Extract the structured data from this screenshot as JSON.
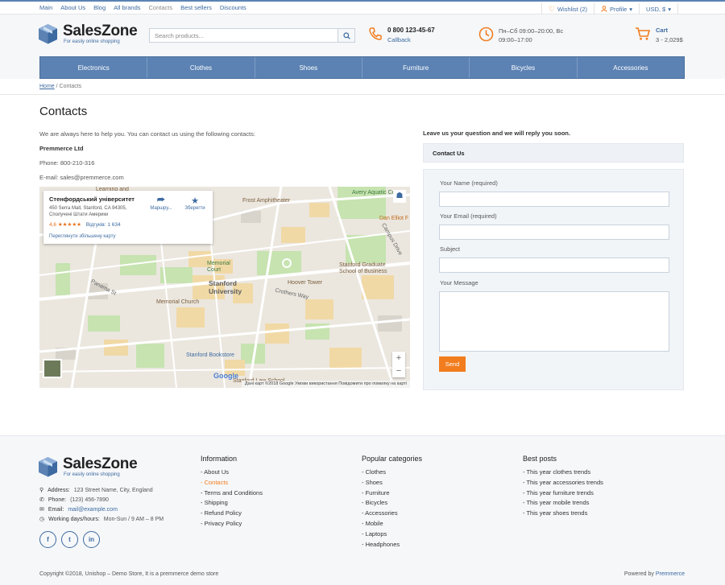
{
  "topnav": {
    "items": [
      "Main",
      "About Us",
      "Blog",
      "All brands",
      "Contacts",
      "Best sellers",
      "Discounts"
    ],
    "active_index": 4
  },
  "topright": {
    "wishlist": "Wishlist (2)",
    "profile": "Profile",
    "currency": "USD, $"
  },
  "header": {
    "logo_title": "SalesZone",
    "logo_subtitle": "For easily online shopping",
    "search_placeholder": "Search products...",
    "phone_number": "0 800 123-45-67",
    "callback": "Callback",
    "hours_line1": "Пн–Сб 09:00–20:00, Вс",
    "hours_line2": "09:00–17:00",
    "cart_label": "Cart",
    "cart_summary": "3 - 2,029$"
  },
  "mainnav": [
    "Electronics",
    "Clothes",
    "Shoes",
    "Furniture",
    "Bicycles",
    "Accessories"
  ],
  "breadcrumb": {
    "home": "Home",
    "sep": "/",
    "current": "Contacts"
  },
  "content": {
    "title": "Contacts",
    "intro": "We are always here to help you. You can contact us using the following contacts:",
    "company": "Premmerce Ltd",
    "phone": "Phone: 800-210-316",
    "email": "E-mail: sales@premmerce.com"
  },
  "map": {
    "card_title": "Стенфордський університет",
    "card_address": "450 Serra Mall, Stanford, CA 94305, Сполучені Штати Америки",
    "rating": "4,6 ★★★★★",
    "reviews": "Відгуків: 1 634",
    "larger_map": "Переглянути збільшену карту",
    "route_btn": "Маршру...",
    "save_btn": "Зберегти",
    "labels": {
      "learning": "Learning and",
      "frost": "Frost Amphitheater",
      "avery": "Avery Aquatic Ce",
      "dan": "Dan Elliot F",
      "campus": "Campus Drive",
      "memorial_court": "Memorial Court",
      "stanford": "Stanford University",
      "gsb": "Stanford Graduate School of Business",
      "hoover": "Hoover Tower",
      "memorial_church": "Memorial Church",
      "bookstore": "Stanford Bookstore",
      "law": "Stanford Law School",
      "panama": "Panama St",
      "crothers": "Crothers Way",
      "google": "Google"
    },
    "footer": "Дані карт ©2018 Google   Умови використання   Повідомити про помилку на карті",
    "zoom_in": "+",
    "zoom_out": "−"
  },
  "form": {
    "lead": "Leave us your question and we will reply you soon.",
    "heading": "Contact Us",
    "name_label": "Your Name (required)",
    "email_label": "Your Email (required)",
    "subject_label": "Subject",
    "message_label": "Your Message",
    "send": "Send"
  },
  "footer": {
    "logo_title": "SalesZone",
    "logo_subtitle": "For easily online shopping",
    "address_label": "Address:",
    "address": "123 Street Name, City, England",
    "phone_label": "Phone:",
    "phone": "(123) 456-7890",
    "email_label": "Email:",
    "email": "mail@example.com",
    "hours_label": "Working days/hours:",
    "hours": "Mon-Sun / 9 AM – 8 PM",
    "socials": [
      "f",
      "t",
      "in"
    ],
    "info": {
      "title": "Information",
      "links": [
        "- About Us",
        "- Contacts",
        "- Terms and Conditions",
        "- Shipping",
        "- Refund Policy",
        "- Privacy Policy"
      ],
      "active_index": 1
    },
    "categories": {
      "title": "Popular categories",
      "links": [
        "- Clothes",
        "- Shoes",
        "- Furniture",
        "- Bicycles",
        "- Accessories",
        "- Mobile",
        "- Laptops",
        "- Headphones"
      ]
    },
    "posts": {
      "title": "Best posts",
      "links": [
        "- This year clothes trends",
        "- This year accessories trends",
        "- This year furniture trends",
        "- This year mobile trends",
        "- This year shoes trends"
      ]
    },
    "copyright": "Copyright ©2018, Unishop – Demo Store, It is a premmerce demo store",
    "powered_prefix": "Powered by",
    "powered_brand": "Premmerce"
  },
  "colors": {
    "accent": "#5b82b3",
    "orange": "#f27d1f",
    "link": "#3d6aa0"
  }
}
